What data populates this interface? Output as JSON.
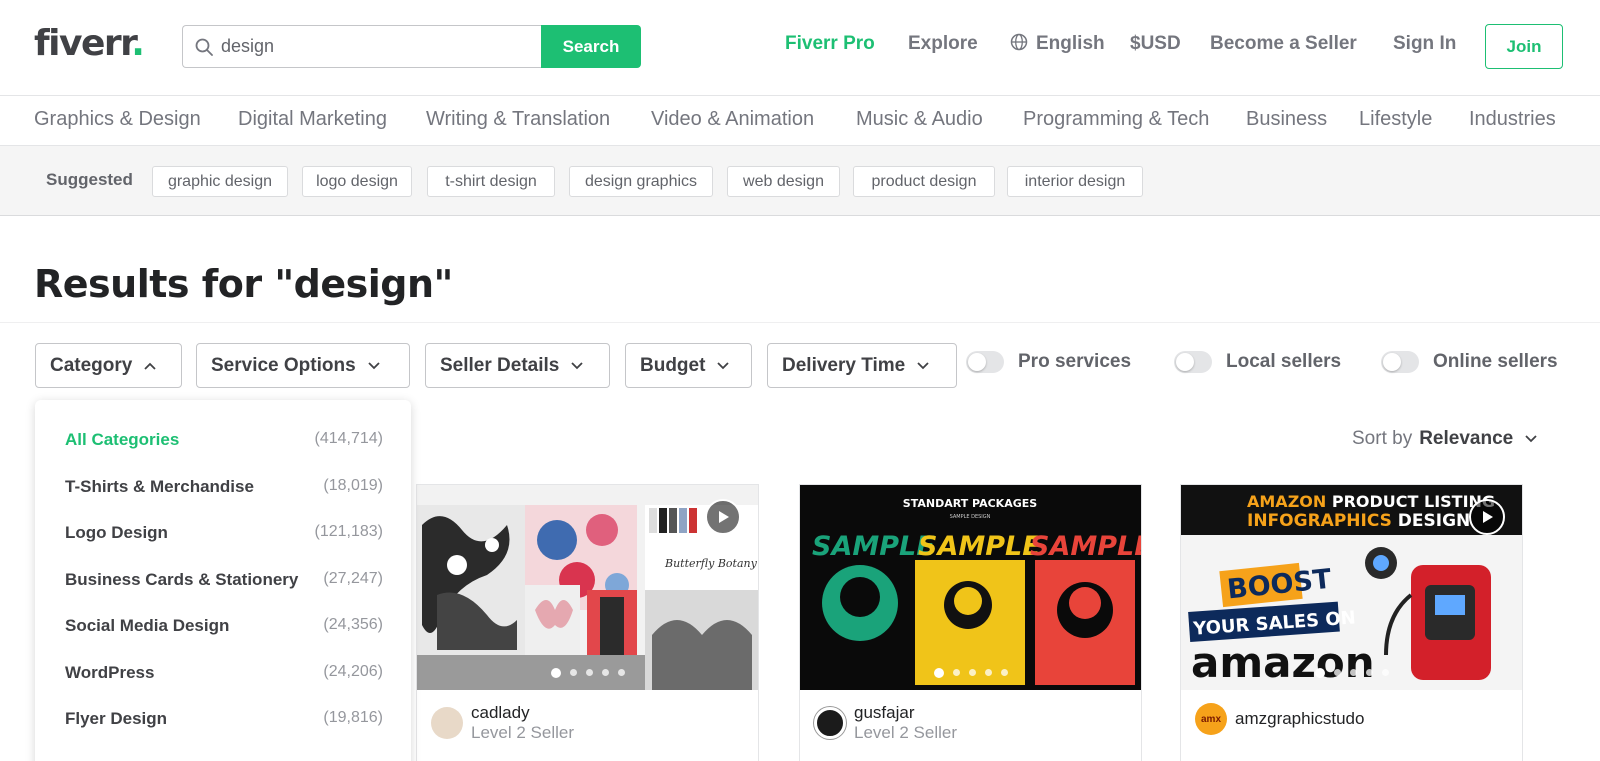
{
  "header": {
    "logo_text": "fiverr",
    "logo_dot": ".",
    "search_value": "design",
    "search_button": "Search",
    "nav": {
      "pro": "Fiverr Pro",
      "explore": "Explore",
      "language": "English",
      "currency": "$USD",
      "become_seller": "Become a Seller",
      "sign_in": "Sign In",
      "join": "Join"
    },
    "brand_color": "#1dbf73"
  },
  "categories": [
    "Graphics & Design",
    "Digital Marketing",
    "Writing & Translation",
    "Video & Animation",
    "Music & Audio",
    "Programming & Tech",
    "Business",
    "Lifestyle",
    "Industries"
  ],
  "suggested": {
    "label": "Suggested",
    "tags": [
      "graphic design",
      "logo design",
      "t-shirt design",
      "design graphics",
      "web design",
      "product design",
      "interior design"
    ]
  },
  "results_title": "Results for \"design\"",
  "filters": {
    "dropdowns": [
      "Category",
      "Service Options",
      "Seller Details",
      "Budget",
      "Delivery Time"
    ],
    "toggles": [
      "Pro services",
      "Local sellers",
      "Online sellers"
    ]
  },
  "category_dropdown": {
    "items": [
      {
        "label": "All Categories",
        "count": "(414,714)",
        "active": true
      },
      {
        "label": "T-Shirts & Merchandise",
        "count": "(18,019)"
      },
      {
        "label": "Logo Design",
        "count": "(121,183)"
      },
      {
        "label": "Business Cards & Stationery",
        "count": "(27,247)"
      },
      {
        "label": "Social Media Design",
        "count": "(24,356)"
      },
      {
        "label": "WordPress",
        "count": "(24,206)"
      },
      {
        "label": "Flyer Design",
        "count": "(19,816)"
      }
    ]
  },
  "sort": {
    "label": "Sort by",
    "value": "Relevance"
  },
  "gigs": [
    {
      "seller": "cadlady",
      "level": "Level 2 Seller",
      "thumb_caption": "Butterfly Botany"
    },
    {
      "seller": "gusfajar",
      "level": "Level 2 Seller",
      "thumb_title": "STANDART PACKAGES",
      "thumb_subtitle": "SAMPLE DESIGN",
      "thumb_word": "SAMPLE"
    },
    {
      "seller": "amzgraphicstudo",
      "thumb_line1a": "AMAZON",
      "thumb_line1b": " PRODUCT LISTING",
      "thumb_line2a": "INFOGRAPHICS",
      "thumb_line2b": " DESIGN",
      "thumb_boost": "BOOST",
      "thumb_sales": "YOUR SALES ON",
      "thumb_amazon": "amazon",
      "avatar_text": "amx"
    }
  ]
}
